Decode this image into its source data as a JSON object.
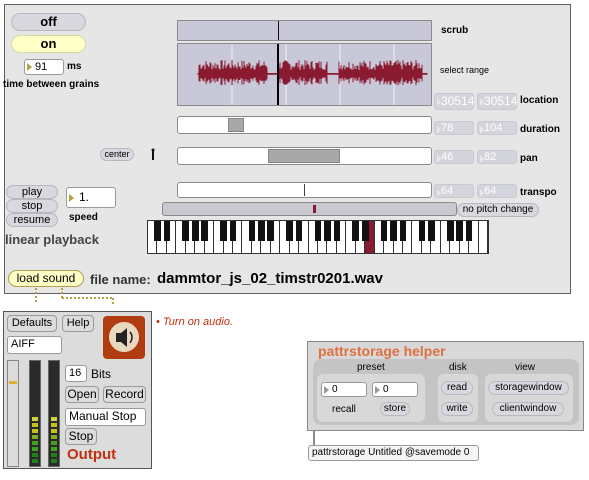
{
  "player": {
    "off_label": "off",
    "on_label": "on",
    "grain_ms_value": "91",
    "ms_label": "ms",
    "time_between_grains_label": "time between grains",
    "play_label": "play",
    "stop_label": "stop",
    "resume_label": "resume",
    "speed_value": "1.",
    "speed_label": "speed",
    "linear_playback_label": "linear playback",
    "scrub_label": "scrub",
    "select_range_label": "select range",
    "location_label": "location",
    "location_values": [
      "30514",
      "30514"
    ],
    "duration_label": "duration",
    "duration_values": [
      "78",
      "104"
    ],
    "center_label": "center",
    "pan_label": "pan",
    "pan_values": [
      "46",
      "82"
    ],
    "transpo_label": "transpo",
    "transpo_values": [
      "64",
      "64"
    ],
    "no_pitch_change_label": "no pitch change",
    "load_sound_label": "load sound",
    "file_name_label": "file name:",
    "file_name_value": "dammtor_js_02_timstr0201.wav"
  },
  "output": {
    "defaults_label": "Defaults",
    "help_label": "Help",
    "format_value": "AIFF",
    "bits_value": "16",
    "bits_label": "Bits",
    "open_label": "Open",
    "record_label": "Record",
    "mode_value": "Manual Stop",
    "stop_label": "Stop",
    "title": "Output",
    "speaker_icon": "speaker-icon",
    "turn_on_audio_note": "• Turn on audio."
  },
  "pattr_helper": {
    "title": "pattrstorage helper",
    "preset_label": "preset",
    "disk_label": "disk",
    "view_label": "view",
    "recall_value": "0",
    "store_value": "0",
    "recall_label": "recall",
    "store_label": "store",
    "read_label": "read",
    "write_label": "write",
    "storagewindow_label": "storagewindow",
    "clientwindow_label": "clientwindow"
  },
  "pattrstorage_object": "pattrstorage Untitled @savemode 0",
  "colors": {
    "on_button": "#ffffc8",
    "output_title": "#c03010",
    "note_text": "#c03010",
    "pattr_title": "#e07040",
    "waveform": "#8a1a30",
    "speaker_bg": "#b03c10"
  }
}
